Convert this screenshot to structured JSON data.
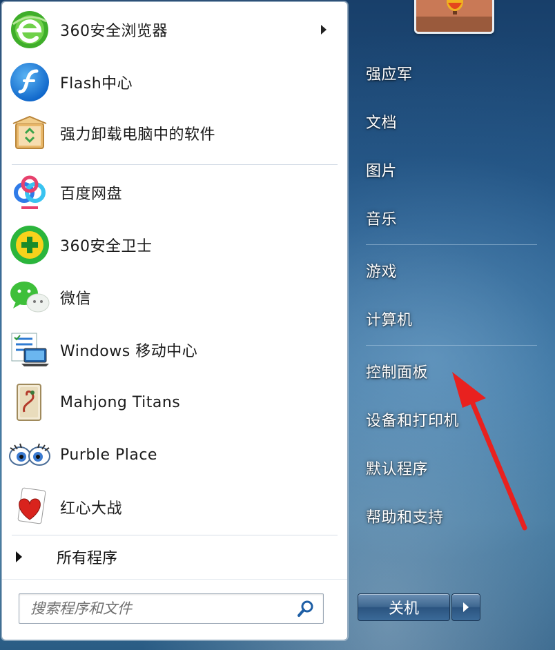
{
  "programs": [
    {
      "label": "360安全浏览器",
      "icon": "360-browser-icon",
      "has_submenu": true
    },
    {
      "label": "Flash中心",
      "icon": "flash-center-icon",
      "has_submenu": false
    },
    {
      "label": "强力卸载电脑中的软件",
      "icon": "uninstaller-box-icon",
      "has_submenu": false
    },
    {
      "label": "百度网盘",
      "icon": "baidu-netdisk-icon",
      "has_submenu": false
    },
    {
      "label": "360安全卫士",
      "icon": "360-safeguard-icon",
      "has_submenu": false
    },
    {
      "label": "微信",
      "icon": "wechat-icon",
      "has_submenu": false
    },
    {
      "label": "Windows 移动中心",
      "icon": "mobility-center-icon",
      "has_submenu": false
    },
    {
      "label": "Mahjong Titans",
      "icon": "mahjong-tile-icon",
      "has_submenu": false
    },
    {
      "label": "Purble Place",
      "icon": "purble-eyes-icon",
      "has_submenu": false
    },
    {
      "label": "红心大战",
      "icon": "hearts-card-icon",
      "has_submenu": false
    }
  ],
  "all_programs": "所有程序",
  "search": {
    "placeholder": "搜索程序和文件"
  },
  "right_links": [
    {
      "label": "强应军"
    },
    {
      "label": "文档"
    },
    {
      "label": "图片"
    },
    {
      "label": "音乐"
    },
    {
      "label": "游戏"
    },
    {
      "label": "计算机"
    },
    {
      "label": "控制面板"
    },
    {
      "label": "设备和打印机"
    },
    {
      "label": "默认程序"
    },
    {
      "label": "帮助和支持"
    }
  ],
  "shutdown": {
    "label": "关机"
  },
  "colors": {
    "annotation_arrow": "#e8211f",
    "panel_bg": "#ffffff",
    "aero_blue": "#24598a"
  }
}
